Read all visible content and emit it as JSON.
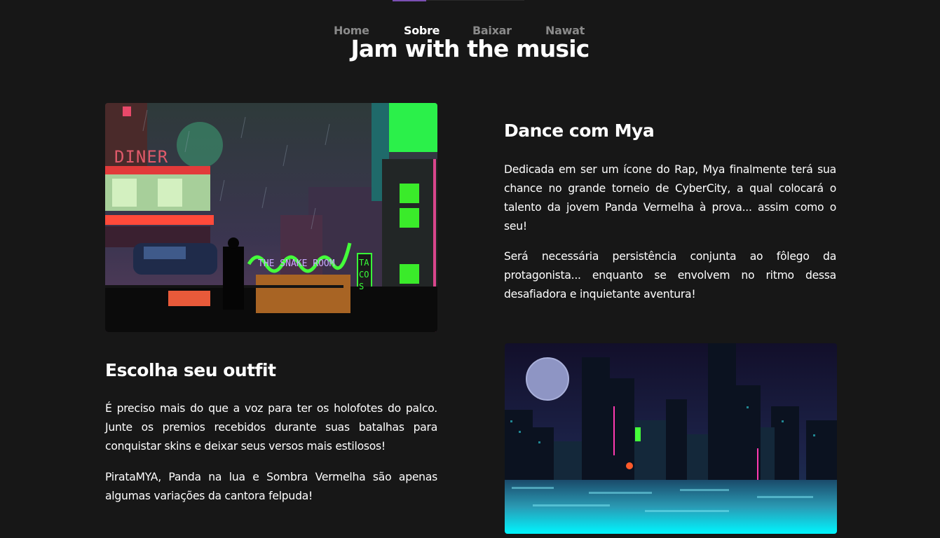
{
  "nav": {
    "items": [
      {
        "label": "Home",
        "active": false
      },
      {
        "label": "Sobre",
        "active": true
      },
      {
        "label": "Baixar",
        "active": false
      },
      {
        "label": "Nawat",
        "active": false
      }
    ]
  },
  "hero": {
    "title": "Jam with the music"
  },
  "section_dance": {
    "heading": "Dance com Mya",
    "paragraphs": [
      "Dedicada em ser um ícone do Rap, Mya finalmente terá sua chance no grande torneio de CyberCity, a qual colocará o talento da jovem Panda Vermelha à prova... assim como o seu!",
      "Será necessária persistência conjunta ao fôlego da protagonista... enquanto se envolvem no ritmo dessa desafiadora e inquietante aventura!"
    ]
  },
  "section_outfit": {
    "heading": "Escolha seu outfit",
    "paragraphs": [
      "É preciso mais do que a voz para ter os holofotes do palco. Junte os premios recebidos durante suas batalhas para conquistar skins e deixar seus versos mais estilosos!",
      "PirataMYA, Panda na lua e Sombra Vermelha são apenas algumas variações da cantora felpuda!"
    ]
  },
  "art_city_street": {
    "signs": [
      "DINER",
      "THE SNAKE ROOM",
      "TACOS"
    ]
  },
  "colors": {
    "background": "#171717",
    "nav_inactive": "#8a8a8a",
    "nav_active": "#ffffff",
    "accent": "#7b4fb3"
  }
}
